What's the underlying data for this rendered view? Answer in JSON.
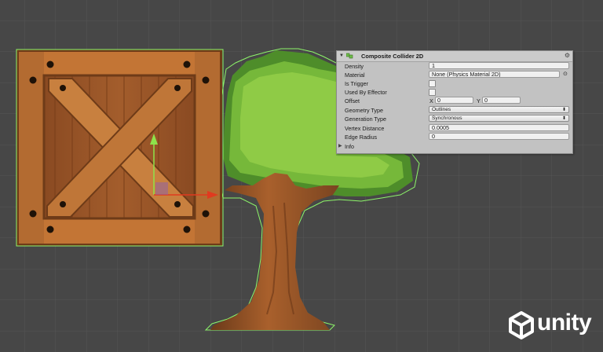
{
  "scene": {
    "colors": {
      "background": "#474747",
      "grid": "#565656",
      "collider": "#8df56a",
      "gizmo_y": "#8ee34a",
      "gizmo_x": "#e03a1f"
    },
    "objects": [
      "crate-sprite",
      "tree-sprite"
    ]
  },
  "inspector": {
    "component_title": "Composite Collider 2D",
    "rows": {
      "density": {
        "label": "Density",
        "value": "1"
      },
      "material": {
        "label": "Material",
        "value": "None (Physics Material 2D)"
      },
      "is_trigger": {
        "label": "Is Trigger",
        "checked": false
      },
      "used_by_effector": {
        "label": "Used By Effector",
        "checked": false
      },
      "offset": {
        "label": "Offset",
        "x_label": "X",
        "x": "0",
        "y_label": "Y",
        "y": "0"
      },
      "geometry_type": {
        "label": "Geometry Type",
        "value": "Outlines"
      },
      "generation_type": {
        "label": "Generation Type",
        "value": "Synchronous"
      },
      "vertex_distance": {
        "label": "Vertex Distance",
        "value": "0.0005"
      },
      "edge_radius": {
        "label": "Edge Radius",
        "value": "0"
      },
      "info": {
        "label": "Info"
      }
    }
  },
  "logo": {
    "text": "unity",
    "icon": "unity-cube-icon"
  }
}
